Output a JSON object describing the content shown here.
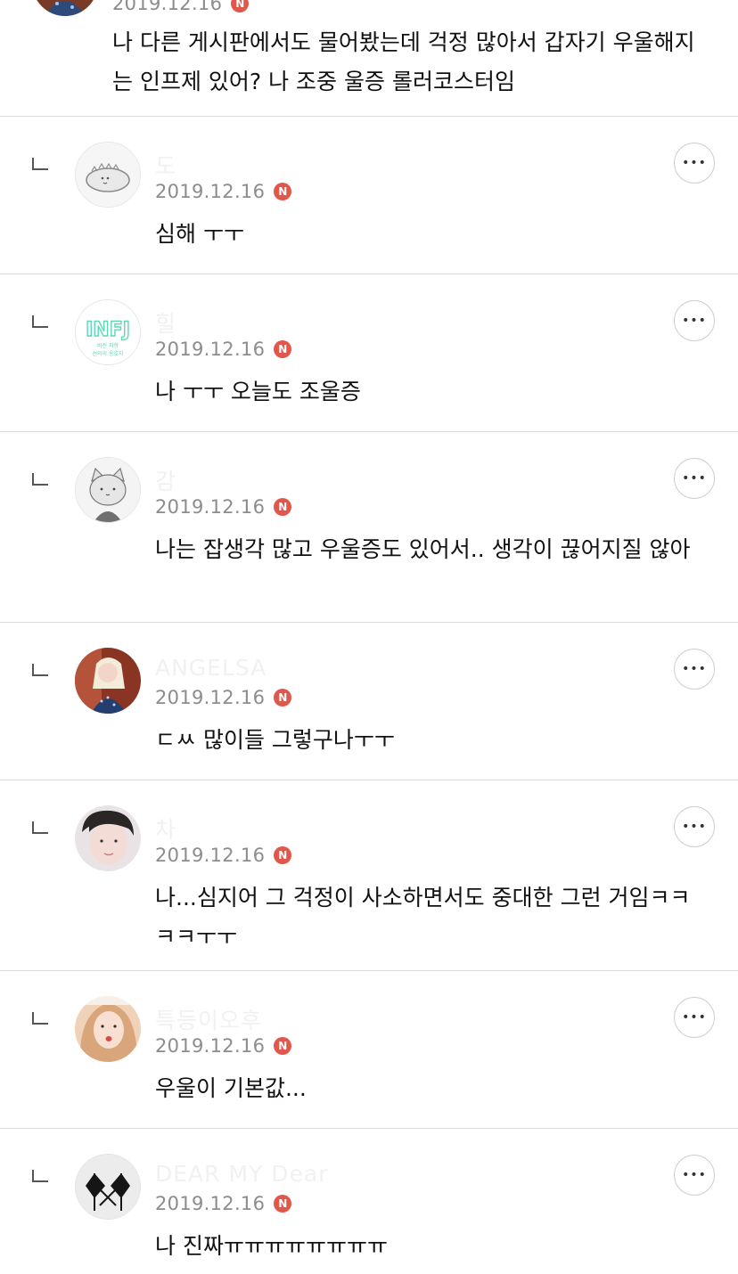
{
  "comments": [
    {
      "nick": "",
      "date": "2019.12.16",
      "badge": "N",
      "text": "나 다른 게시판에서도 물어봤는데 걱정 많아서 갑자기 우울해지는 인프제 있어? 나 조중 울증 롤러코스터임",
      "avatar": "elsa-avatar"
    },
    {
      "nick": "도",
      "date": "2019.12.16",
      "badge": "N",
      "text": "심해 ㅜㅜ",
      "avatar": "dinosaur-avatar"
    },
    {
      "nick": "힐",
      "date": "2019.12.16",
      "badge": "N",
      "text": "나 ㅜㅜ 오늘도 조울증",
      "avatar": "infj-avatar",
      "avatar_text": "INFJ",
      "avatar_sub1": "비전 지향",
      "avatar_sub2": "선의의 옹호자"
    },
    {
      "nick": "감",
      "date": "2019.12.16",
      "badge": "N",
      "text": "나는 잡생각 많고 우울증도 있어서.. 생각이 끊어지질 않아",
      "avatar": "cat-avatar"
    },
    {
      "nick": "ANGELSA",
      "date": "2019.12.16",
      "badge": "N",
      "text": "ㄷㅆ 많이들 그렇구나ㅜㅜ",
      "avatar": "elsa-avatar"
    },
    {
      "nick": "차",
      "date": "2019.12.16",
      "badge": "N",
      "text": "나...심지어 그 걱정이 사소하면서도 중대한 그런 거임ㅋㅋㅋㅋㅜㅜ",
      "avatar": "portrait-avatar"
    },
    {
      "nick": "특등이오후",
      "date": "2019.12.16",
      "badge": "N",
      "text": "우울이 기본값...",
      "avatar": "selfie-avatar"
    },
    {
      "nick": "DEAR MY Dear",
      "date": "2019.12.16",
      "badge": "N",
      "text": "나 진짜ㅠㅠㅠㅠㅠㅠㅠㅠ",
      "avatar": "flags-avatar"
    }
  ],
  "more_label": "•••",
  "colors": {
    "badge": "#e2574c",
    "divider": "#dedede",
    "date": "#8c8c8c"
  }
}
